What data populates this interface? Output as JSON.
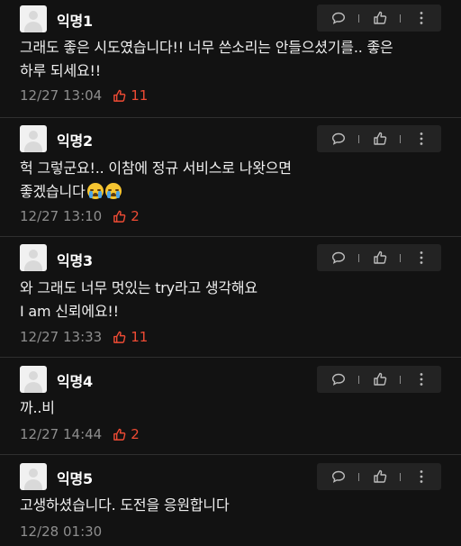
{
  "colors": {
    "background": "#121212",
    "name": "#ffffff",
    "meta": "#8e8e8e",
    "like_accent": "#ef4b34",
    "action_bar": "#232323"
  },
  "comments": [
    {
      "author": "익명1",
      "line1": "그래도 좋은 시도였습니다!! 너무 쓴소리는 안들으셨기를.. 좋은",
      "line2": "하루 되세요!!",
      "timestamp": "12/27 13:04",
      "likes": "11"
    },
    {
      "author": "익명2",
      "line1": "헉 그렇군요!.. 이참에 정규 서비스로 나왓으면",
      "line2": "좋겠습니다",
      "timestamp": "12/27 13:10",
      "likes": "2"
    },
    {
      "author": "익명3",
      "line1": "와 그래도 너무 멋있는 try라고 생각해요",
      "line2": "I am 신뢰에요!!",
      "timestamp": "12/27 13:33",
      "likes": "11"
    },
    {
      "author": "익명4",
      "line1": "까..비",
      "timestamp": "12/27 14:44",
      "likes": "2"
    },
    {
      "author": "익명5",
      "line1": "고생하셨습니다. 도전을 응원합니다",
      "timestamp": "12/28 01:30"
    }
  ],
  "icons": {
    "reply": "speech-bubble-icon",
    "like": "thumbs-up-icon",
    "more": "vertical-ellipsis-icon",
    "emoji": "loudly-crying-face-emoji"
  }
}
